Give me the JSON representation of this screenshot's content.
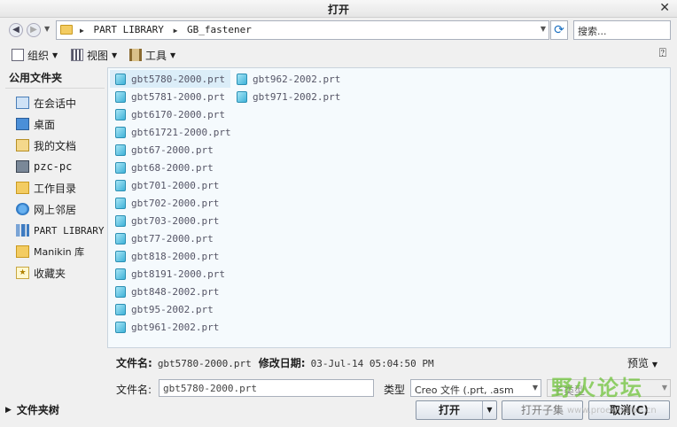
{
  "window": {
    "title": "打开",
    "close_glyph": "✕"
  },
  "address": {
    "crumbs": [
      "PART LIBRARY",
      "GB_fastener"
    ],
    "search_placeholder": "搜索..."
  },
  "toolbar": {
    "organize": "组织",
    "view": "视图",
    "tools": "工具",
    "help_glyph": "⍰"
  },
  "sidebar": {
    "header": "公用文件夹",
    "items": [
      {
        "label": "在会话中",
        "icon": "session-icon"
      },
      {
        "label": "桌面",
        "icon": "desktop-icon"
      },
      {
        "label": "我的文档",
        "icon": "documents-icon"
      },
      {
        "label": "pzc-pc",
        "icon": "computer-icon"
      },
      {
        "label": "工作目录",
        "icon": "working-directory-icon"
      },
      {
        "label": "网上邻居",
        "icon": "network-icon"
      },
      {
        "label": "PART LIBRARY",
        "icon": "library-icon"
      },
      {
        "label": "Manikin 库",
        "icon": "manikin-folder-icon"
      },
      {
        "label": "收藏夹",
        "icon": "favorites-icon"
      }
    ],
    "folder_tree": "文件夹树"
  },
  "files": {
    "col1": [
      "gbt5780-2000.prt",
      "gbt5781-2000.prt",
      "gbt6170-2000.prt",
      "gbt61721-2000.prt",
      "gbt67-2000.prt",
      "gbt68-2000.prt",
      "gbt701-2000.prt",
      "gbt702-2000.prt",
      "gbt703-2000.prt",
      "gbt77-2000.prt",
      "gbt818-2000.prt",
      "gbt8191-2000.prt",
      "gbt848-2002.prt",
      "gbt95-2002.prt",
      "gbt961-2002.prt"
    ],
    "col2": [
      "gbt962-2002.prt",
      "gbt971-2002.prt"
    ],
    "selected": "gbt5780-2000.prt"
  },
  "details": {
    "filename_label": "文件名:",
    "filename_value": "gbt5780-2000.prt",
    "modified_label": "修改日期:",
    "modified_value": "03-Jul-14 05:04:50 PM",
    "preview": "预览"
  },
  "bottom": {
    "filename_label": "文件名:",
    "filename_value": "gbt5780-2000.prt",
    "type_label": "类型",
    "type_value": "Creo 文件 (.prt, .asm",
    "subtype": "子类型",
    "open": "打开",
    "open_subset": "打开子集",
    "cancel": "取消(C)"
  },
  "watermark": {
    "logo": "野火论坛",
    "url": "www.proewildfire.cn"
  }
}
